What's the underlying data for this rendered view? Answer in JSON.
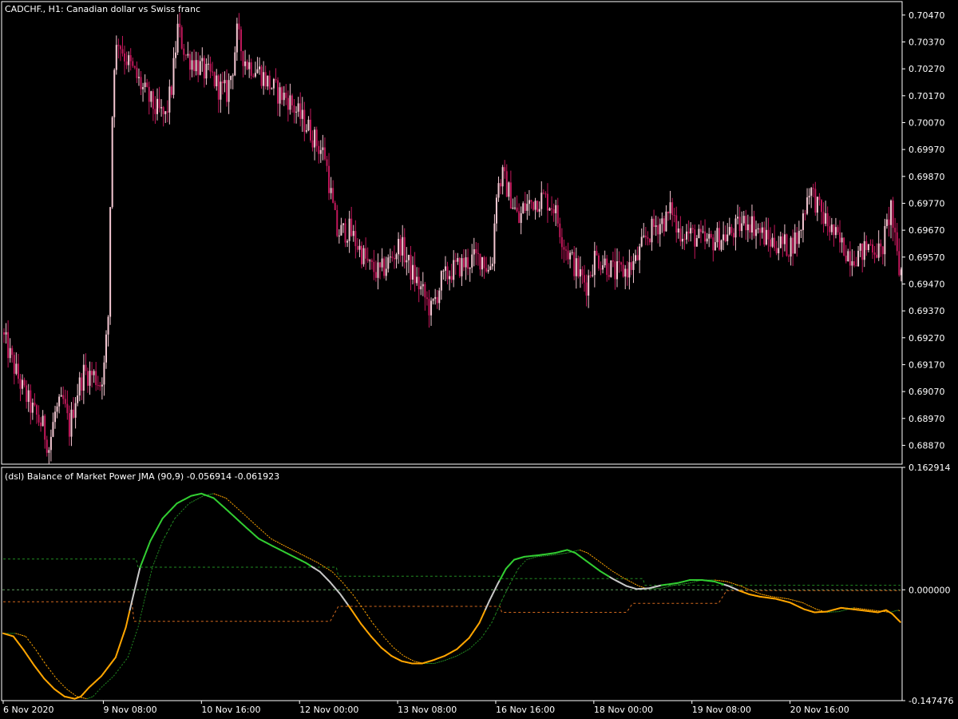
{
  "chart_data": [
    {
      "type": "candlestick",
      "title": "CADCHF., H1:  Canadian dollar vs Swiss franc",
      "ylim": [
        0.688,
        0.7052
      ],
      "yticks": [
        "0.70470",
        "0.70370",
        "0.70270",
        "0.70170",
        "0.70070",
        "0.69970",
        "0.69870",
        "0.69770",
        "0.69670",
        "0.69570",
        "0.69470",
        "0.69370",
        "0.69270",
        "0.69170",
        "0.69070",
        "0.68970",
        "0.68870"
      ],
      "keypoints": [
        [
          0,
          0.6929
        ],
        [
          5,
          0.6918
        ],
        [
          10,
          0.6908
        ],
        [
          15,
          0.69
        ],
        [
          20,
          0.6894
        ],
        [
          23,
          0.6886
        ],
        [
          26,
          0.6899
        ],
        [
          30,
          0.6903
        ],
        [
          33,
          0.6893
        ],
        [
          36,
          0.6905
        ],
        [
          40,
          0.6914
        ],
        [
          45,
          0.6913
        ],
        [
          48,
          0.691
        ],
        [
          50,
          0.6916
        ],
        [
          52,
          0.6935
        ],
        [
          53,
          0.6977
        ],
        [
          54,
          0.701
        ],
        [
          55,
          0.703
        ],
        [
          57,
          0.7038
        ],
        [
          60,
          0.7032
        ],
        [
          65,
          0.7025
        ],
        [
          70,
          0.7018
        ],
        [
          75,
          0.7012
        ],
        [
          80,
          0.7009
        ],
        [
          83,
          0.702
        ],
        [
          86,
          0.7042
        ],
        [
          90,
          0.7032
        ],
        [
          95,
          0.7029
        ],
        [
          100,
          0.7025
        ],
        [
          103,
          0.7024
        ],
        [
          106,
          0.702
        ],
        [
          110,
          0.7018
        ],
        [
          113,
          0.7028
        ],
        [
          115,
          0.704
        ],
        [
          118,
          0.7032
        ],
        [
          120,
          0.7029
        ],
        [
          125,
          0.7027
        ],
        [
          130,
          0.7022
        ],
        [
          135,
          0.7018
        ],
        [
          140,
          0.7016
        ],
        [
          145,
          0.701
        ],
        [
          150,
          0.7005
        ],
        [
          155,
          0.6998
        ],
        [
          158,
          0.6995
        ],
        [
          160,
          0.6985
        ],
        [
          162,
          0.6975
        ],
        [
          164,
          0.6966
        ],
        [
          170,
          0.6967
        ],
        [
          175,
          0.696
        ],
        [
          180,
          0.6953
        ],
        [
          185,
          0.6951
        ],
        [
          190,
          0.6956
        ],
        [
          195,
          0.6962
        ],
        [
          200,
          0.6952
        ],
        [
          205,
          0.6945
        ],
        [
          210,
          0.6937
        ],
        [
          215,
          0.6948
        ],
        [
          220,
          0.6952
        ],
        [
          225,
          0.6954
        ],
        [
          230,
          0.6956
        ],
        [
          235,
          0.6957
        ],
        [
          238,
          0.6952
        ],
        [
          240,
          0.6957
        ],
        [
          242,
          0.6982
        ],
        [
          245,
          0.6987
        ],
        [
          250,
          0.6977
        ],
        [
          253,
          0.697
        ],
        [
          255,
          0.6975
        ],
        [
          260,
          0.6978
        ],
        [
          265,
          0.6979
        ],
        [
          270,
          0.6976
        ],
        [
          275,
          0.6962
        ],
        [
          280,
          0.6954
        ],
        [
          283,
          0.695
        ],
        [
          286,
          0.6947
        ],
        [
          290,
          0.6957
        ],
        [
          295,
          0.6955
        ],
        [
          300,
          0.6951
        ],
        [
          305,
          0.6952
        ],
        [
          310,
          0.6955
        ],
        [
          315,
          0.6964
        ],
        [
          320,
          0.6969
        ],
        [
          325,
          0.6971
        ],
        [
          328,
          0.6975
        ],
        [
          330,
          0.6967
        ],
        [
          335,
          0.6966
        ],
        [
          340,
          0.6964
        ],
        [
          345,
          0.6962
        ],
        [
          350,
          0.6964
        ],
        [
          355,
          0.6965
        ],
        [
          360,
          0.6968
        ],
        [
          365,
          0.6971
        ],
        [
          370,
          0.6967
        ],
        [
          375,
          0.6963
        ],
        [
          380,
          0.6962
        ],
        [
          385,
          0.6961
        ],
        [
          390,
          0.6965
        ],
        [
          393,
          0.6976
        ],
        [
          395,
          0.6983
        ],
        [
          398,
          0.6978
        ],
        [
          400,
          0.6974
        ],
        [
          405,
          0.6968
        ],
        [
          410,
          0.6962
        ],
        [
          415,
          0.6958
        ],
        [
          420,
          0.6958
        ],
        [
          425,
          0.6962
        ],
        [
          428,
          0.696
        ],
        [
          430,
          0.6958
        ],
        [
          433,
          0.6968
        ],
        [
          435,
          0.6976
        ],
        [
          437,
          0.6962
        ],
        [
          439,
          0.6952
        ]
      ],
      "n_bars": 440
    },
    {
      "type": "line",
      "title": "(dsl) Balance of Market Power JMA (90,9) -0.056914 -0.061923",
      "ylim": [
        -0.147476,
        0.162914
      ],
      "yticks": [
        "0.162914",
        "0.000000",
        "-0.147476"
      ],
      "levels": {
        "zero": 0.0
      },
      "main_line": [
        [
          0,
          -0.058
        ],
        [
          5,
          -0.062
        ],
        [
          10,
          -0.08
        ],
        [
          15,
          -0.1
        ],
        [
          20,
          -0.118
        ],
        [
          25,
          -0.132
        ],
        [
          30,
          -0.142
        ],
        [
          35,
          -0.145
        ],
        [
          38,
          -0.142
        ],
        [
          42,
          -0.13
        ],
        [
          48,
          -0.115
        ],
        [
          55,
          -0.09
        ],
        [
          60,
          -0.05
        ],
        [
          63,
          -0.015
        ],
        [
          67,
          0.03
        ],
        [
          72,
          0.065
        ],
        [
          78,
          0.095
        ],
        [
          85,
          0.115
        ],
        [
          92,
          0.125
        ],
        [
          97,
          0.128
        ],
        [
          103,
          0.122
        ],
        [
          110,
          0.105
        ],
        [
          118,
          0.085
        ],
        [
          125,
          0.068
        ],
        [
          132,
          0.058
        ],
        [
          140,
          0.047
        ],
        [
          148,
          0.036
        ],
        [
          155,
          0.024
        ],
        [
          160,
          0.01
        ],
        [
          165,
          -0.006
        ],
        [
          170,
          -0.025
        ],
        [
          175,
          -0.045
        ],
        [
          180,
          -0.062
        ],
        [
          185,
          -0.077
        ],
        [
          190,
          -0.088
        ],
        [
          195,
          -0.095
        ],
        [
          200,
          -0.098
        ],
        [
          205,
          -0.098
        ],
        [
          210,
          -0.094
        ],
        [
          216,
          -0.088
        ],
        [
          222,
          -0.079
        ],
        [
          228,
          -0.064
        ],
        [
          233,
          -0.044
        ],
        [
          238,
          -0.014
        ],
        [
          242,
          0.008
        ],
        [
          246,
          0.028
        ],
        [
          250,
          0.04
        ],
        [
          255,
          0.044
        ],
        [
          262,
          0.046
        ],
        [
          270,
          0.049
        ],
        [
          276,
          0.053
        ],
        [
          280,
          0.049
        ],
        [
          285,
          0.039
        ],
        [
          292,
          0.025
        ],
        [
          298,
          0.015
        ],
        [
          305,
          0.005
        ],
        [
          310,
          0.001
        ],
        [
          316,
          0.002
        ],
        [
          322,
          0.006
        ],
        [
          330,
          0.009
        ],
        [
          336,
          0.013
        ],
        [
          342,
          0.013
        ],
        [
          348,
          0.011
        ],
        [
          355,
          0.005
        ],
        [
          360,
          -0.001
        ],
        [
          365,
          -0.006
        ],
        [
          370,
          -0.009
        ],
        [
          378,
          -0.012
        ],
        [
          385,
          -0.017
        ],
        [
          392,
          -0.026
        ],
        [
          397,
          -0.03
        ],
        [
          403,
          -0.029
        ],
        [
          410,
          -0.024
        ],
        [
          416,
          -0.026
        ],
        [
          422,
          -0.028
        ],
        [
          428,
          -0.03
        ],
        [
          432,
          -0.027
        ],
        [
          435,
          -0.032
        ],
        [
          439,
          -0.043
        ]
      ],
      "signal_lag": 6,
      "level_up": [
        [
          0,
          0.041
        ],
        [
          65,
          0.041
        ],
        [
          66,
          0.03
        ],
        [
          163,
          0.03
        ],
        [
          164,
          0.018
        ],
        [
          243,
          0.018
        ],
        [
          244,
          0.015
        ],
        [
          313,
          0.015
        ],
        [
          314,
          0.006
        ],
        [
          439,
          0.006
        ]
      ],
      "level_down": [
        [
          0,
          -0.016
        ],
        [
          63,
          -0.016
        ],
        [
          64,
          -0.042
        ],
        [
          160,
          -0.042
        ],
        [
          164,
          -0.022
        ],
        [
          243,
          -0.022
        ],
        [
          244,
          -0.03
        ],
        [
          305,
          -0.03
        ],
        [
          308,
          -0.018
        ],
        [
          350,
          -0.018
        ],
        [
          354,
          -0.001
        ],
        [
          439,
          -0.001
        ]
      ]
    }
  ],
  "time_axis": {
    "labels": [
      {
        "bar": 0,
        "text": "6 Nov 2020"
      },
      {
        "bar": 49,
        "text": "9 Nov 08:00"
      },
      {
        "bar": 97,
        "text": "10 Nov 16:00"
      },
      {
        "bar": 145,
        "text": "12 Nov 00:00"
      },
      {
        "bar": 193,
        "text": "13 Nov 08:00"
      },
      {
        "bar": 241,
        "text": "16 Nov 16:00"
      },
      {
        "bar": 289,
        "text": "18 Nov 00:00"
      },
      {
        "bar": 337,
        "text": "19 Nov 08:00"
      },
      {
        "bar": 385,
        "text": "20 Nov 16:00"
      }
    ]
  },
  "colors": {
    "background": "#000000",
    "frame": "#ffffff",
    "candle_up": "#f4c7d2",
    "candle_down": "#c2185b",
    "line_up": "#32cd32",
    "line_down": "#ffa500",
    "line_neutral": "#c8c8c8",
    "level_up": "#228b22",
    "level_down": "#d2691e",
    "zero_level": "#5f9f5f"
  }
}
